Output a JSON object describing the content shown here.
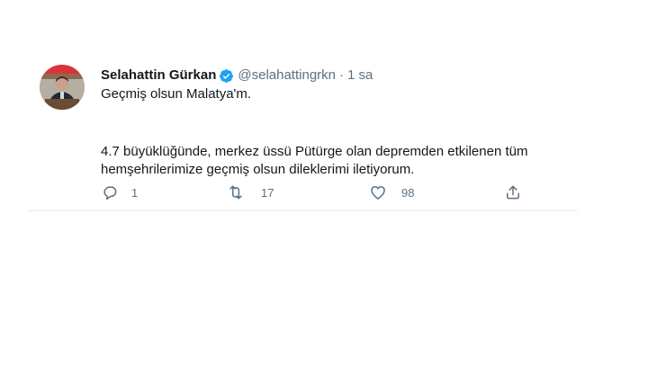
{
  "tweet": {
    "author_name": "Selahattin Gürkan",
    "handle": "@selahattingrkn",
    "separator": "·",
    "time": "1 sa",
    "text_line1": "Geçmiş olsun Malatya'm.",
    "text_line2": "4.7 büyüklüğünde, merkez üssü Pütürge olan depremden etkilenen tüm",
    "text_line3": "hemşehrilerimize geçmiş olsun dileklerimi iletiyorum.",
    "reply_count": "1",
    "retweet_count": "17",
    "like_count": "98"
  },
  "icons": {
    "verified": "verified-badge-icon",
    "reply": "reply-icon",
    "retweet": "retweet-icon",
    "like": "like-icon",
    "share": "share-icon"
  },
  "colors": {
    "verified": "#1da1f2",
    "muted": "#5b7083",
    "text": "#14171a"
  }
}
